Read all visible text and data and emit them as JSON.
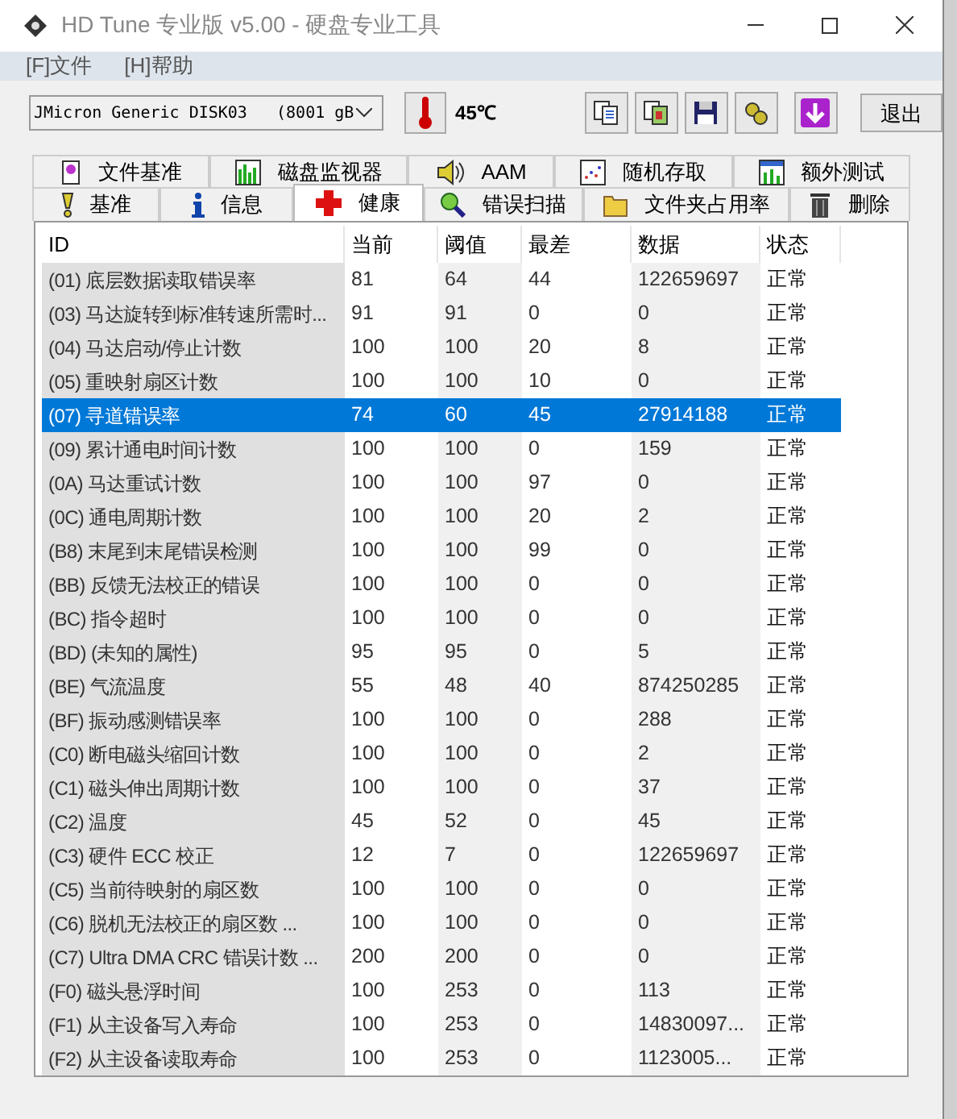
{
  "window": {
    "title": "HD Tune 专业版 v5.00 - 硬盘专业工具"
  },
  "menu": [
    "[F]文件",
    "[H]帮助"
  ],
  "toolbar": {
    "drive": "JMicron Generic DISK03   (8001 gB",
    "temperature": "45℃",
    "exit": "退出"
  },
  "tabs": [
    [
      {
        "label": "文件基准",
        "selected": false
      },
      {
        "label": "磁盘监视器",
        "selected": false
      },
      {
        "label": "AAM",
        "selected": false
      },
      {
        "label": "随机存取",
        "selected": false
      },
      {
        "label": "额外测试",
        "selected": false
      }
    ],
    [
      {
        "label": "基准",
        "selected": false
      },
      {
        "label": "信息",
        "selected": false
      },
      {
        "label": "健康",
        "selected": true
      },
      {
        "label": "错误扫描",
        "selected": false
      },
      {
        "label": "文件夹占用率",
        "selected": false
      },
      {
        "label": "删除",
        "selected": false
      }
    ]
  ],
  "table": {
    "columns": [
      "ID",
      "当前",
      "阈值",
      "最差",
      "数据",
      "状态"
    ],
    "rows": [
      {
        "cells": [
          "(01) 底层数据读取错误率",
          "81",
          "64",
          "44",
          "122659697",
          "正常"
        ],
        "selected": false
      },
      {
        "cells": [
          "(03) 马达旋转到标准转速所需时...",
          "91",
          "91",
          "0",
          "0",
          "正常"
        ],
        "selected": false
      },
      {
        "cells": [
          "(04) 马达启动/停止计数",
          "100",
          "100",
          "20",
          "8",
          "正常"
        ],
        "selected": false
      },
      {
        "cells": [
          "(05) 重映射扇区计数",
          "100",
          "100",
          "10",
          "0",
          "正常"
        ],
        "selected": false
      },
      {
        "cells": [
          "(07) 寻道错误率",
          "74",
          "60",
          "45",
          "27914188",
          "正常"
        ],
        "selected": true
      },
      {
        "cells": [
          "(09) 累计通电时间计数",
          "100",
          "100",
          "0",
          "159",
          "正常"
        ],
        "selected": false
      },
      {
        "cells": [
          "(0A) 马达重试计数",
          "100",
          "100",
          "97",
          "0",
          "正常"
        ],
        "selected": false
      },
      {
        "cells": [
          "(0C) 通电周期计数",
          "100",
          "100",
          "20",
          "2",
          "正常"
        ],
        "selected": false
      },
      {
        "cells": [
          "(B8) 末尾到末尾错误检测",
          "100",
          "100",
          "99",
          "0",
          "正常"
        ],
        "selected": false
      },
      {
        "cells": [
          "(BB) 反馈无法校正的错误",
          "100",
          "100",
          "0",
          "0",
          "正常"
        ],
        "selected": false
      },
      {
        "cells": [
          "(BC) 指令超时",
          "100",
          "100",
          "0",
          "0",
          "正常"
        ],
        "selected": false
      },
      {
        "cells": [
          "(BD) (未知的属性)",
          "95",
          "95",
          "0",
          "5",
          "正常"
        ],
        "selected": false
      },
      {
        "cells": [
          "(BE) 气流温度",
          "55",
          "48",
          "40",
          "874250285",
          "正常"
        ],
        "selected": false
      },
      {
        "cells": [
          "(BF) 振动感测错误率",
          "100",
          "100",
          "0",
          "288",
          "正常"
        ],
        "selected": false
      },
      {
        "cells": [
          "(C0) 断电磁头缩回计数",
          "100",
          "100",
          "0",
          "2",
          "正常"
        ],
        "selected": false
      },
      {
        "cells": [
          "(C1) 磁头伸出周期计数",
          "100",
          "100",
          "0",
          "37",
          "正常"
        ],
        "selected": false
      },
      {
        "cells": [
          "(C2) 温度",
          "45",
          "52",
          "0",
          "45",
          "正常"
        ],
        "selected": false
      },
      {
        "cells": [
          "(C3) 硬件 ECC 校正",
          "12",
          "7",
          "0",
          "122659697",
          "正常"
        ],
        "selected": false
      },
      {
        "cells": [
          "(C5) 当前待映射的扇区数",
          "100",
          "100",
          "0",
          "0",
          "正常"
        ],
        "selected": false
      },
      {
        "cells": [
          "(C6) 脱机无法校正的扇区数    ...",
          "100",
          "100",
          "0",
          "0",
          "正常"
        ],
        "selected": false
      },
      {
        "cells": [
          "(C7) Ultra DMA CRC 错误计数 ...",
          "200",
          "200",
          "0",
          "0",
          "正常"
        ],
        "selected": false
      },
      {
        "cells": [
          "(F0) 磁头悬浮时间",
          "100",
          "253",
          "0",
          "113",
          "正常"
        ],
        "selected": false
      },
      {
        "cells": [
          "(F1) 从主设备写入寿命",
          "100",
          "253",
          "0",
          "14830097...",
          "正常"
        ],
        "selected": false
      },
      {
        "cells": [
          "(F2) 从主设备读取寿命",
          "100",
          "253",
          "0",
          "1123005...",
          "正常"
        ],
        "selected": false
      }
    ]
  }
}
